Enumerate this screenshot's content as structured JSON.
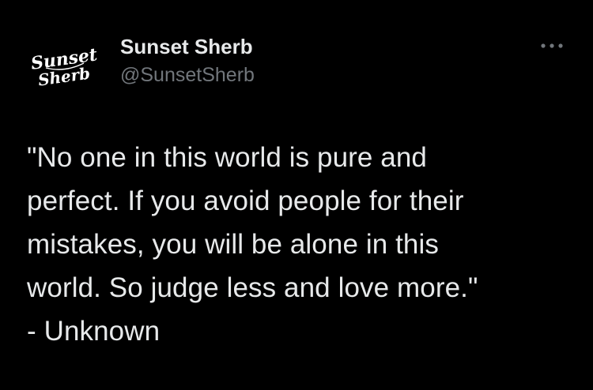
{
  "author": {
    "name": "Sunset Sherb",
    "handle": "@SunsetSherb",
    "avatar_logo_lines": [
      "Sunset",
      "Sherb"
    ]
  },
  "menu": {
    "icon": "more-horizontal-icon"
  },
  "tweet": {
    "text": "\"No one in this world is pure and\nperfect. If you avoid people for their\nmistakes, you will be alone in this\nworld. So judge less and love more.\"\n- Unknown"
  },
  "colors": {
    "background": "#000000",
    "primary_text": "#e7e9ea",
    "secondary_text": "#71767b"
  }
}
